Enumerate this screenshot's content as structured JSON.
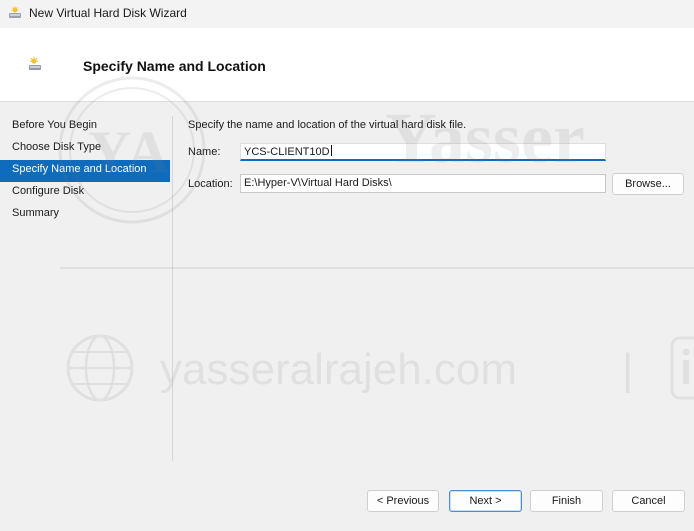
{
  "window": {
    "title": "New Virtual Hard Disk Wizard"
  },
  "header": {
    "title": "Specify Name and Location"
  },
  "nav": {
    "items": [
      {
        "label": "Before You Begin"
      },
      {
        "label": "Choose Disk Type"
      },
      {
        "label": "Specify Name and Location"
      },
      {
        "label": "Configure Disk"
      },
      {
        "label": "Summary"
      }
    ],
    "active_index": 2
  },
  "content": {
    "instruction": "Specify the name and location of the virtual hard disk file.",
    "name_label": "Name:",
    "name_value": "YCS-CLIENT10D",
    "location_label": "Location:",
    "location_value": "E:\\Hyper-V\\Virtual Hard Disks\\",
    "browse_label": "Browse..."
  },
  "footer": {
    "previous_label": "< Previous",
    "next_label": "Next >",
    "finish_label": "Finish",
    "cancel_label": "Cancel"
  },
  "watermark": {
    "logo_text": "YA",
    "name_text": "Yasser",
    "site_text": "yasseralrajeh.com",
    "separator": "|"
  },
  "colors": {
    "accent": "#0f6cbd",
    "header_bg": "#ffffff",
    "body_bg": "#f0f0f0"
  }
}
